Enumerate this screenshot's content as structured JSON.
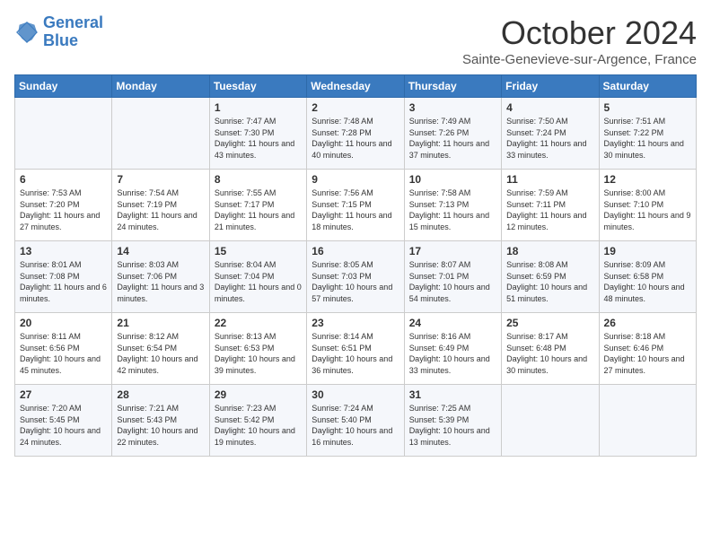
{
  "header": {
    "logo_line1": "General",
    "logo_line2": "Blue",
    "month": "October 2024",
    "location": "Sainte-Genevieve-sur-Argence, France"
  },
  "days_of_week": [
    "Sunday",
    "Monday",
    "Tuesday",
    "Wednesday",
    "Thursday",
    "Friday",
    "Saturday"
  ],
  "weeks": [
    [
      {
        "day": "",
        "info": ""
      },
      {
        "day": "",
        "info": ""
      },
      {
        "day": "1",
        "info": "Sunrise: 7:47 AM\nSunset: 7:30 PM\nDaylight: 11 hours and 43 minutes."
      },
      {
        "day": "2",
        "info": "Sunrise: 7:48 AM\nSunset: 7:28 PM\nDaylight: 11 hours and 40 minutes."
      },
      {
        "day": "3",
        "info": "Sunrise: 7:49 AM\nSunset: 7:26 PM\nDaylight: 11 hours and 37 minutes."
      },
      {
        "day": "4",
        "info": "Sunrise: 7:50 AM\nSunset: 7:24 PM\nDaylight: 11 hours and 33 minutes."
      },
      {
        "day": "5",
        "info": "Sunrise: 7:51 AM\nSunset: 7:22 PM\nDaylight: 11 hours and 30 minutes."
      }
    ],
    [
      {
        "day": "6",
        "info": "Sunrise: 7:53 AM\nSunset: 7:20 PM\nDaylight: 11 hours and 27 minutes."
      },
      {
        "day": "7",
        "info": "Sunrise: 7:54 AM\nSunset: 7:19 PM\nDaylight: 11 hours and 24 minutes."
      },
      {
        "day": "8",
        "info": "Sunrise: 7:55 AM\nSunset: 7:17 PM\nDaylight: 11 hours and 21 minutes."
      },
      {
        "day": "9",
        "info": "Sunrise: 7:56 AM\nSunset: 7:15 PM\nDaylight: 11 hours and 18 minutes."
      },
      {
        "day": "10",
        "info": "Sunrise: 7:58 AM\nSunset: 7:13 PM\nDaylight: 11 hours and 15 minutes."
      },
      {
        "day": "11",
        "info": "Sunrise: 7:59 AM\nSunset: 7:11 PM\nDaylight: 11 hours and 12 minutes."
      },
      {
        "day": "12",
        "info": "Sunrise: 8:00 AM\nSunset: 7:10 PM\nDaylight: 11 hours and 9 minutes."
      }
    ],
    [
      {
        "day": "13",
        "info": "Sunrise: 8:01 AM\nSunset: 7:08 PM\nDaylight: 11 hours and 6 minutes."
      },
      {
        "day": "14",
        "info": "Sunrise: 8:03 AM\nSunset: 7:06 PM\nDaylight: 11 hours and 3 minutes."
      },
      {
        "day": "15",
        "info": "Sunrise: 8:04 AM\nSunset: 7:04 PM\nDaylight: 11 hours and 0 minutes."
      },
      {
        "day": "16",
        "info": "Sunrise: 8:05 AM\nSunset: 7:03 PM\nDaylight: 10 hours and 57 minutes."
      },
      {
        "day": "17",
        "info": "Sunrise: 8:07 AM\nSunset: 7:01 PM\nDaylight: 10 hours and 54 minutes."
      },
      {
        "day": "18",
        "info": "Sunrise: 8:08 AM\nSunset: 6:59 PM\nDaylight: 10 hours and 51 minutes."
      },
      {
        "day": "19",
        "info": "Sunrise: 8:09 AM\nSunset: 6:58 PM\nDaylight: 10 hours and 48 minutes."
      }
    ],
    [
      {
        "day": "20",
        "info": "Sunrise: 8:11 AM\nSunset: 6:56 PM\nDaylight: 10 hours and 45 minutes."
      },
      {
        "day": "21",
        "info": "Sunrise: 8:12 AM\nSunset: 6:54 PM\nDaylight: 10 hours and 42 minutes."
      },
      {
        "day": "22",
        "info": "Sunrise: 8:13 AM\nSunset: 6:53 PM\nDaylight: 10 hours and 39 minutes."
      },
      {
        "day": "23",
        "info": "Sunrise: 8:14 AM\nSunset: 6:51 PM\nDaylight: 10 hours and 36 minutes."
      },
      {
        "day": "24",
        "info": "Sunrise: 8:16 AM\nSunset: 6:49 PM\nDaylight: 10 hours and 33 minutes."
      },
      {
        "day": "25",
        "info": "Sunrise: 8:17 AM\nSunset: 6:48 PM\nDaylight: 10 hours and 30 minutes."
      },
      {
        "day": "26",
        "info": "Sunrise: 8:18 AM\nSunset: 6:46 PM\nDaylight: 10 hours and 27 minutes."
      }
    ],
    [
      {
        "day": "27",
        "info": "Sunrise: 7:20 AM\nSunset: 5:45 PM\nDaylight: 10 hours and 24 minutes."
      },
      {
        "day": "28",
        "info": "Sunrise: 7:21 AM\nSunset: 5:43 PM\nDaylight: 10 hours and 22 minutes."
      },
      {
        "day": "29",
        "info": "Sunrise: 7:23 AM\nSunset: 5:42 PM\nDaylight: 10 hours and 19 minutes."
      },
      {
        "day": "30",
        "info": "Sunrise: 7:24 AM\nSunset: 5:40 PM\nDaylight: 10 hours and 16 minutes."
      },
      {
        "day": "31",
        "info": "Sunrise: 7:25 AM\nSunset: 5:39 PM\nDaylight: 10 hours and 13 minutes."
      },
      {
        "day": "",
        "info": ""
      },
      {
        "day": "",
        "info": ""
      }
    ]
  ]
}
